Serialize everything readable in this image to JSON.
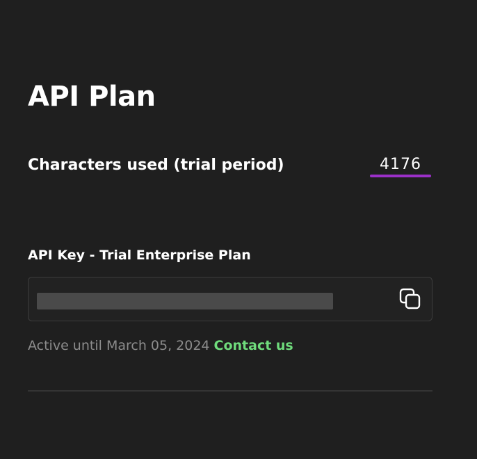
{
  "page": {
    "title": "API Plan"
  },
  "usage": {
    "label": "Characters used (trial period)",
    "value": "4176",
    "accent_color": "#9b30c8"
  },
  "api_key": {
    "label": "API Key - Trial Enterprise Plan",
    "copy_icon": "copy-icon"
  },
  "status": {
    "active_text": "Active until March 05, 2024",
    "contact_label": "Contact us",
    "contact_color": "#6fdc7c"
  }
}
